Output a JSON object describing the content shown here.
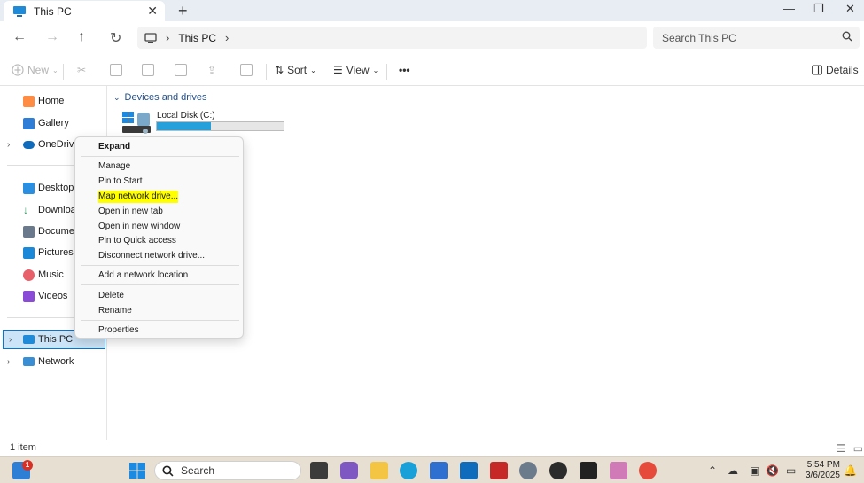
{
  "window": {
    "tab_title": "This PC",
    "new_tab": "+",
    "close_tab": "✕",
    "minimize": "—",
    "restore": "❐",
    "close": "✕"
  },
  "nav": {
    "back": "←",
    "forward": "→",
    "up": "↑",
    "refresh": "↻",
    "breadcrumb": [
      "This PC"
    ],
    "search_placeholder": "Search This PC"
  },
  "toolbar": {
    "new_label": "New",
    "sort_label": "Sort",
    "view_label": "View",
    "more_label": "•••",
    "details_label": "Details"
  },
  "sidebar": {
    "items": [
      {
        "label": "Home"
      },
      {
        "label": "Gallery"
      },
      {
        "label": "OneDrive"
      },
      {
        "label": "Desktop"
      },
      {
        "label": "Download"
      },
      {
        "label": "Document"
      },
      {
        "label": "Pictures"
      },
      {
        "label": "Music"
      },
      {
        "label": "Videos"
      },
      {
        "label": "This PC"
      },
      {
        "label": "Network"
      }
    ]
  },
  "main": {
    "section_title": "Devices and drives",
    "drives": [
      {
        "name": "Local Disk (C:)",
        "used_fraction": 0.43
      }
    ]
  },
  "context_menu": {
    "items": [
      "Expand",
      "Manage",
      "Pin to Start",
      "Map network drive...",
      "Open in new tab",
      "Open in new window",
      "Pin to Quick access",
      "Disconnect network drive...",
      "Add a network location",
      "Delete",
      "Rename",
      "Properties"
    ]
  },
  "status": {
    "item_count": "1 item"
  },
  "taskbar": {
    "search_label": "Search",
    "notification_count": "1",
    "time": "5:54 PM",
    "date": "3/6/2025"
  },
  "colors": {
    "accent": "#0078d4",
    "drive_fill": "#26a0da",
    "highlight": "#ffff00",
    "taskbar": "#e7dfd2"
  }
}
